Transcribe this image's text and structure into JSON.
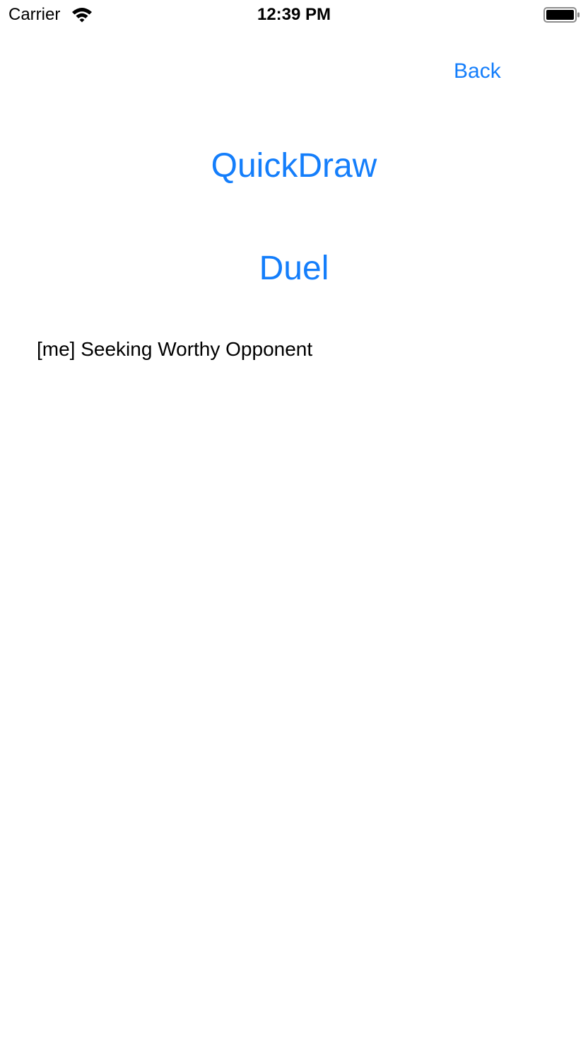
{
  "status_bar": {
    "carrier": "Carrier",
    "time": "12:39 PM",
    "wifi_icon": "wifi-icon",
    "battery_icon": "battery-icon",
    "battery_level": 1.0
  },
  "nav": {
    "back_label": "Back"
  },
  "main": {
    "quickdraw_label": "QuickDraw",
    "duel_label": "Duel",
    "status_message": "[me] Seeking Worthy Opponent"
  },
  "colors": {
    "accent": "#147efb",
    "text": "#000000",
    "background": "#ffffff"
  }
}
